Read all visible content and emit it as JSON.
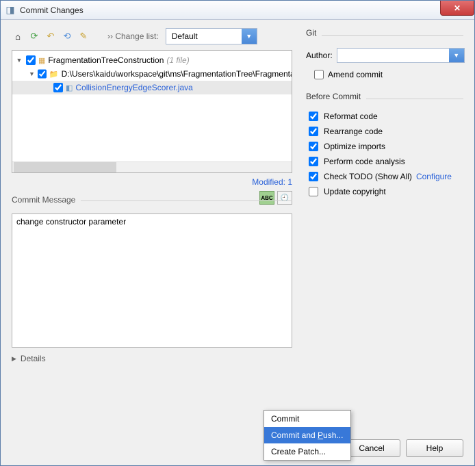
{
  "window": {
    "title": "Commit Changes"
  },
  "toolbar": {
    "change_list_label": "›› Change list:",
    "combo_value": "Default"
  },
  "tree": {
    "root_label": "FragmentationTreeConstruction",
    "root_hint": "(1 file)",
    "path_label": "D:\\Users\\kaidu\\workspace\\git\\ms\\FragmentationTree\\FragmentationTreeConstruction",
    "file_label": "CollisionEnergyEdgeScorer.java"
  },
  "status": {
    "modified": "Modified: 1"
  },
  "commit_message": {
    "label": "Commit Message",
    "value": "change constructor parameter"
  },
  "details": {
    "label": "Details"
  },
  "git": {
    "section": "Git",
    "author_label": "Author:",
    "author_value": "",
    "amend_label": "Amend commit"
  },
  "before_commit": {
    "section": "Before Commit",
    "items": [
      {
        "label": "Reformat code",
        "checked": true
      },
      {
        "label": "Rearrange code",
        "checked": true
      },
      {
        "label": "Optimize imports",
        "checked": true
      },
      {
        "label": "Perform code analysis",
        "checked": true
      },
      {
        "label": "Check TODO (Show All)",
        "checked": true,
        "link": "Configure"
      },
      {
        "label": "Update copyright",
        "checked": false
      }
    ]
  },
  "buttons": {
    "commit": "Commit",
    "cancel": "Cancel",
    "help": "Help"
  },
  "menu": {
    "item1": "Commit",
    "item2_pre": "Commit and ",
    "item2_ul": "P",
    "item2_post": "ush...",
    "item3": "Create Patch..."
  }
}
